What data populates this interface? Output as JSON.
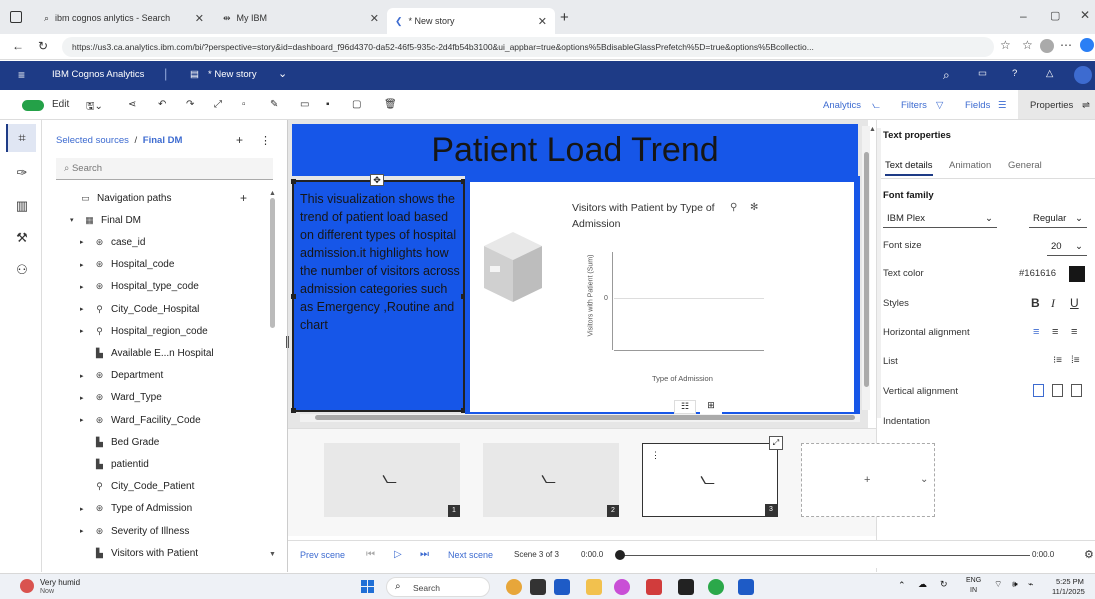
{
  "browser": {
    "tabs": [
      {
        "label": "ibm cognos anlytics - Search"
      },
      {
        "label": "My IBM"
      },
      {
        "label": "* New story"
      }
    ],
    "url": "https://us3.ca.analytics.ibm.com/bi/?perspective=story&id=dashboard_f96d4370-da52-46f5-935c-2d4fb54b3100&ui_appbar=true&options%5BdisableGlassPrefetch%5D=true&options%5Bcollectio..."
  },
  "appbar": {
    "product": "IBM Cognos Analytics",
    "doc_title": "* New story"
  },
  "toolbar": {
    "edit_label": "Edit",
    "analytics_label": "Analytics",
    "filters_label": "Filters",
    "fields_label": "Fields",
    "properties_label": "Properties"
  },
  "datapanel": {
    "crumb_root": "Selected sources",
    "crumb_sep": "/",
    "crumb_current": "Final DM",
    "search_placeholder": "Search",
    "items": [
      {
        "label": "Navigation paths",
        "caret": "",
        "icon": "folder-icon"
      },
      {
        "label": "Final DM",
        "caret": "▾",
        "icon": "table-icon"
      },
      {
        "label": "case_id",
        "caret": "▸",
        "icon": "dimension-icon"
      },
      {
        "label": "Hospital_code",
        "caret": "▸",
        "icon": "dimension-icon"
      },
      {
        "label": "Hospital_type_code",
        "caret": "▸",
        "icon": "dimension-icon"
      },
      {
        "label": "City_Code_Hospital",
        "caret": "▸",
        "icon": "location-icon"
      },
      {
        "label": "Hospital_region_code",
        "caret": "▸",
        "icon": "location-icon"
      },
      {
        "label": "Available E...n Hospital",
        "caret": "",
        "icon": "measure-icon"
      },
      {
        "label": "Department",
        "caret": "▸",
        "icon": "dimension-icon"
      },
      {
        "label": "Ward_Type",
        "caret": "▸",
        "icon": "dimension-icon"
      },
      {
        "label": "Ward_Facility_Code",
        "caret": "▸",
        "icon": "dimension-icon"
      },
      {
        "label": "Bed Grade",
        "caret": "",
        "icon": "measure-icon"
      },
      {
        "label": "patientid",
        "caret": "",
        "icon": "measure-icon"
      },
      {
        "label": "City_Code_Patient",
        "caret": "",
        "icon": "location-icon"
      },
      {
        "label": "Type of Admission",
        "caret": "▸",
        "icon": "dimension-icon"
      },
      {
        "label": "Severity of Illness",
        "caret": "▸",
        "icon": "dimension-icon"
      },
      {
        "label": "Visitors with Patient",
        "caret": "",
        "icon": "measure-icon"
      }
    ]
  },
  "canvas": {
    "title": "Patient Load Trend",
    "description": "This visualization shows the trend of patient load based on different types of hospital admission.it highlights how the number of visitors across admission categories such as Emergency ,Routine and chart",
    "viz_title": "Visitors with Patient by Type of Admission",
    "viz_ylabel": "Visitors with Patient (Sum)",
    "viz_xlabel": "Type of Admission",
    "viz_tick": "0"
  },
  "properties": {
    "heading": "Text properties",
    "tabs": [
      "Text details",
      "Animation",
      "General"
    ],
    "font_family_label": "Font family",
    "font_family_value": "IBM Plex",
    "font_weight_value": "Regular",
    "font_size_label": "Font size",
    "font_size_value": "20",
    "text_color_label": "Text color",
    "text_color_value": "#161616",
    "styles_label": "Styles",
    "horizontal_label": "Horizontal alignment",
    "list_label": "List",
    "vertical_label": "Vertical alignment",
    "indentation_label": "Indentation"
  },
  "scenes": {
    "numbers": [
      "1",
      "2",
      "3"
    ]
  },
  "timeline": {
    "prev_label": "Prev scene",
    "next_label": "Next scene",
    "scene_counter": "Scene 3 of 3",
    "start_time": "0:00.0",
    "end_time": "0:00.0"
  },
  "taskbar": {
    "weather": "Very humid",
    "weather_sub": "Now",
    "search_placeholder": "Search",
    "lang": "ENG",
    "lang_sub": "IN",
    "time": "5:25 PM",
    "date": "11/1/2025"
  },
  "colors": {
    "accent": "#1656e8",
    "header": "#1e3b86"
  }
}
